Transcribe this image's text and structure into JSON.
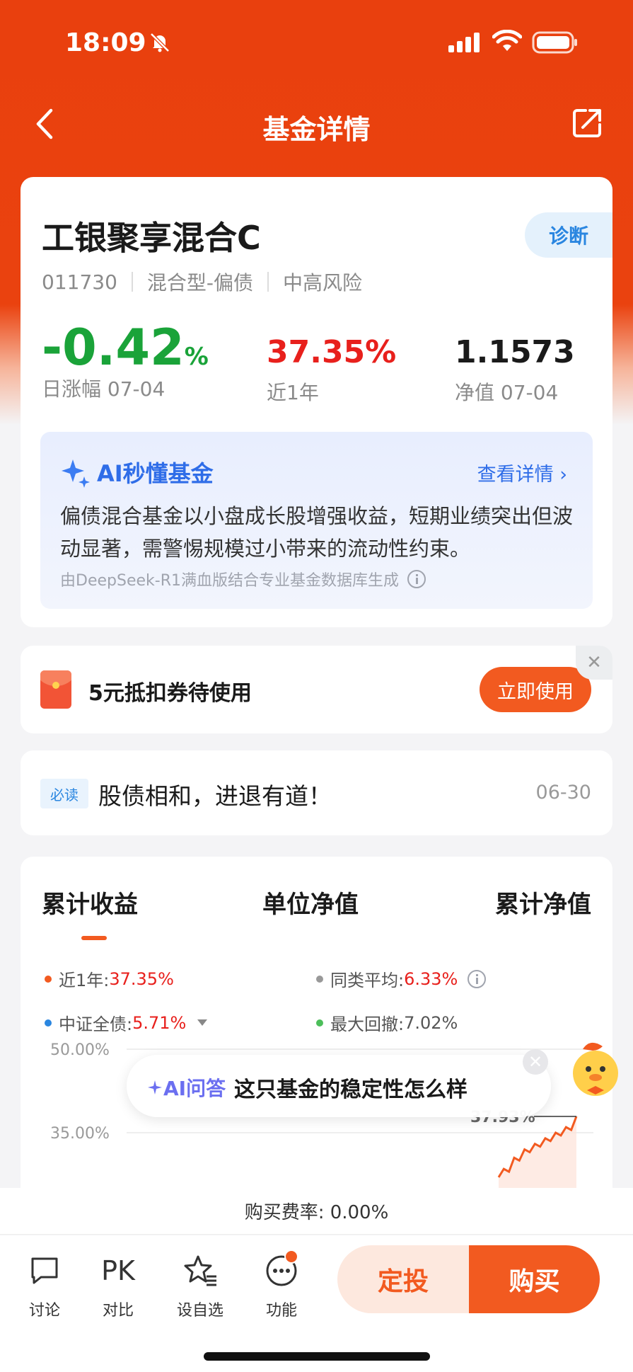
{
  "status_bar": {
    "time": "18:09"
  },
  "nav": {
    "title": "基金详情"
  },
  "fund": {
    "name": "工银聚享混合C",
    "diagnose_label": "诊断",
    "code": "011730",
    "type": "混合型-偏债",
    "risk": "中高风险",
    "daily_change": "-0.42",
    "daily_change_unit": "%",
    "daily_label": "日涨幅 07-04",
    "year_return": "37.35%",
    "year_label": "近1年",
    "nav_value": "1.1573",
    "nav_label": "净值 07-04"
  },
  "ai_summary": {
    "title": "AI秒懂基金",
    "more_label": "查看详情",
    "text": "偏债混合基金以小盘成长股增强收益，短期业绩突出但波动显著，需警惕规模过小带来的流动性约束。",
    "source": "由DeepSeek-R1满血版结合专业基金数据库生成"
  },
  "coupon": {
    "text": "5元抵扣券待使用",
    "button": "立即使用"
  },
  "notice": {
    "tag": "必读",
    "text": "股债相和，进退有道！",
    "date": "06-30"
  },
  "chart_tabs": [
    "累计收益",
    "单位净值",
    "累计净值"
  ],
  "legend": [
    {
      "label": "近1年:",
      "value": "37.35%",
      "color": "#f25a20",
      "value_red": true
    },
    {
      "label": "同类平均:",
      "value": "6.33%",
      "color": "#999999",
      "value_red": true
    },
    {
      "label": "中证全债:",
      "value": "5.71%",
      "color": "#2a86e0",
      "value_red": true
    },
    {
      "label": "最大回撤:",
      "value": "7.02%",
      "color": "#4cbe5a",
      "value_red": false
    }
  ],
  "chart_data": {
    "type": "line",
    "y_ticks": [
      "50.00%",
      "35.00%"
    ],
    "end_label": "37.93%",
    "series": [
      {
        "name": "近1年",
        "values": [
          27.0,
          28.5,
          28.0,
          30.5,
          30.0,
          32.0,
          31.5,
          33.0,
          32.5,
          34.0,
          33.5,
          35.0,
          34.5,
          36.0,
          35.5,
          37.93
        ]
      }
    ]
  },
  "ai_popup": {
    "label": "AI问答",
    "text": "这只基金的稳定性怎么样"
  },
  "fee": {
    "text": "购买费率: 0.00%"
  },
  "bottom_bar": {
    "items": [
      {
        "label": "讨论",
        "icon": "chat-icon"
      },
      {
        "label": "对比",
        "icon": "pk-icon"
      },
      {
        "label": "设自选",
        "icon": "star-list-icon"
      },
      {
        "label": "功能",
        "icon": "more-icon"
      }
    ],
    "pk_text": "PK",
    "dingtou": "定投",
    "buy": "购买"
  },
  "colors": {
    "brand": "#e9400e",
    "accent": "#f25a20",
    "down": "#1aa339",
    "up": "#e8201c",
    "ai_blue": "#2f6de8"
  }
}
